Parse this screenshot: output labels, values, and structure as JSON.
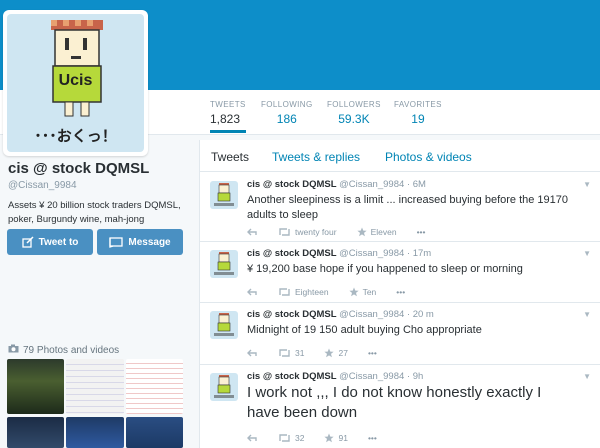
{
  "profile": {
    "avatar_caption": "･･･おくっ！",
    "avatar_badge": "Ucis",
    "name": "cis @ stock DQMSL",
    "handle": "@Cissan_9984",
    "bio": "Assets ¥ 20 billion stock traders DQMSL, poker, Burgundy wine, mah-jong",
    "tweet_to_label": "Tweet to",
    "message_label": "Message",
    "photos_label": "79 Photos and videos"
  },
  "stats": [
    {
      "label": "TWEETS",
      "value": "1,823"
    },
    {
      "label": "FOLLOWING",
      "value": "186"
    },
    {
      "label": "FOLLOWERS",
      "value": "59.3K"
    },
    {
      "label": "FAVORITES",
      "value": "19"
    }
  ],
  "tabs": [
    "Tweets",
    "Tweets & replies",
    "Photos & videos"
  ],
  "tweets": [
    {
      "name": "cis @ stock DQMSL",
      "meta": "@Cissan_9984 · 6M",
      "text": "Another sleepiness is a limit ... increased buying before the 19170 adults to sleep",
      "retweets": "twenty four",
      "favorites": "Eleven",
      "more": "•••"
    },
    {
      "name": "cis @ stock DQMSL",
      "meta": "@Cissan_9984 · 17m",
      "text": "¥ 19,200 base hope if you happened to sleep or morning",
      "retweets": "Eighteen",
      "favorites": "Ten",
      "more": "•••"
    },
    {
      "name": "cis @ stock DQMSL",
      "meta": "@Cissan_9984 · 20 m",
      "text": "Midnight of 19 150 adult buying Cho appropriate",
      "retweets": "31",
      "favorites": "27",
      "more": "•••"
    },
    {
      "name": "cis @ stock DQMSL",
      "meta": "@Cissan_9984 · 9h",
      "text": "I work not ,,, I do not know honestly exactly I have been down",
      "retweets": "32",
      "favorites": "91",
      "more": "•••"
    }
  ],
  "colors": {
    "header": "#0d8ec9",
    "link": "#0084b4",
    "button": "#4a90c2",
    "muted": "#8899a6"
  },
  "icons": {
    "reply": "reply-arrow-icon",
    "retweet": "retweet-icon",
    "favorite": "star-icon",
    "more": "more-dots-icon",
    "caret": "chevron-down-icon",
    "camera": "camera-icon",
    "compose": "compose-icon",
    "message": "message-icon"
  }
}
